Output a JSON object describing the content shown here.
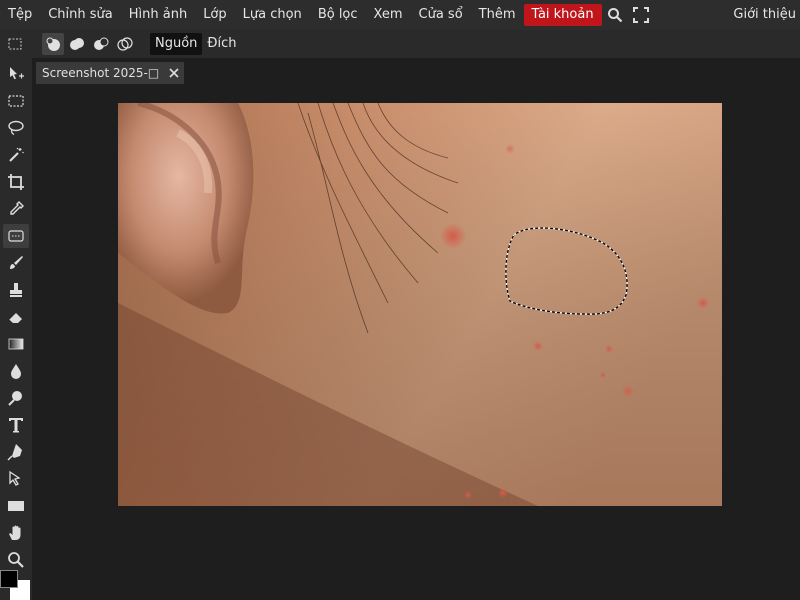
{
  "menubar": {
    "items": [
      "Tệp",
      "Chỉnh sửa",
      "Hình ảnh",
      "Lớp",
      "Lựa chọn",
      "Bộ lọc",
      "Xem",
      "Cửa sổ",
      "Thêm"
    ],
    "account_label": "Tài khoản",
    "right_label": "Giới thiệu",
    "accent_color": "#c0161b"
  },
  "options": {
    "source_label": "Nguồn",
    "dest_label": "Đích"
  },
  "document": {
    "tab_title": "Screenshot 2025-□ *"
  },
  "icons": {
    "menubar": [
      "search-icon",
      "fullscreen-icon"
    ],
    "options": [
      "marquee-icon",
      "new-selection-icon",
      "add-selection-icon",
      "subtract-selection-icon",
      "intersect-selection-icon"
    ],
    "tools": [
      "move-tool-icon",
      "rect-select-icon",
      "lasso-icon",
      "magic-wand-icon",
      "crop-icon",
      "eyedropper-icon",
      "patch-tool-icon",
      "brush-icon",
      "clone-stamp-icon",
      "eraser-icon",
      "gradient-icon",
      "blur-icon",
      "dodge-icon",
      "type-icon",
      "pen-icon",
      "path-select-icon",
      "rectangle-shape-icon",
      "hand-icon",
      "zoom-icon"
    ]
  },
  "colors": {
    "foreground": "#000000",
    "background": "#ffffff"
  }
}
